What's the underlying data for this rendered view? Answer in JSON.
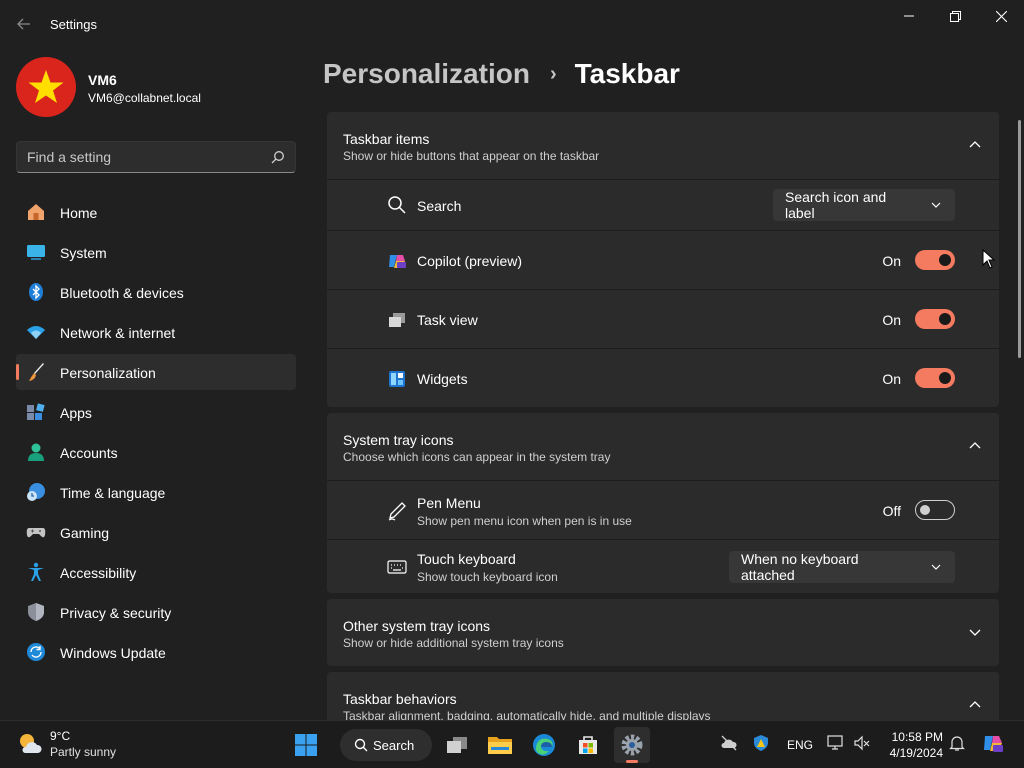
{
  "window": {
    "title": "Settings",
    "controls": [
      "minimize-icon",
      "maximize-icon",
      "close-icon"
    ]
  },
  "profile": {
    "name": "VM6",
    "email": "VM6@collabnet.local"
  },
  "search": {
    "placeholder": "Find a setting"
  },
  "sidebar": {
    "items": [
      {
        "label": "Home",
        "icon": "home-icon"
      },
      {
        "label": "System",
        "icon": "system-icon"
      },
      {
        "label": "Bluetooth & devices",
        "icon": "bluetooth-icon"
      },
      {
        "label": "Network & internet",
        "icon": "wifi-icon"
      },
      {
        "label": "Personalization",
        "icon": "paintbrush-icon",
        "active": true
      },
      {
        "label": "Apps",
        "icon": "apps-icon"
      },
      {
        "label": "Accounts",
        "icon": "accounts-icon"
      },
      {
        "label": "Time & language",
        "icon": "time-language-icon"
      },
      {
        "label": "Gaming",
        "icon": "gamepad-icon"
      },
      {
        "label": "Accessibility",
        "icon": "accessibility-icon"
      },
      {
        "label": "Privacy & security",
        "icon": "shield-icon"
      },
      {
        "label": "Windows Update",
        "icon": "update-icon"
      }
    ]
  },
  "header": {
    "parent": "Personalization",
    "separator": "›",
    "current": "Taskbar"
  },
  "sections": {
    "taskbar_items": {
      "title": "Taskbar items",
      "subtitle": "Show or hide buttons that appear on the taskbar",
      "rows": {
        "search": {
          "label": "Search",
          "value": "Search icon and label"
        },
        "copilot": {
          "label": "Copilot (preview)",
          "state": "On"
        },
        "task_view": {
          "label": "Task view",
          "state": "On"
        },
        "widgets": {
          "label": "Widgets",
          "state": "On"
        }
      }
    },
    "system_tray": {
      "title": "System tray icons",
      "subtitle": "Choose which icons can appear in the system tray",
      "rows": {
        "pen_menu": {
          "label": "Pen Menu",
          "description": "Show pen menu icon when pen is in use",
          "state": "Off"
        },
        "touch_keyboard": {
          "label": "Touch keyboard",
          "description": "Show touch keyboard icon",
          "value": "When no keyboard attached"
        }
      }
    },
    "other_tray": {
      "title": "Other system tray icons",
      "subtitle": "Show or hide additional system tray icons"
    },
    "behaviors": {
      "title": "Taskbar behaviors",
      "subtitle": "Taskbar alignment, badging, automatically hide, and multiple displays"
    }
  },
  "taskbar": {
    "weather": {
      "temp": "9°C",
      "desc": "Partly sunny"
    },
    "search_label": "Search",
    "tray_language": "ENG",
    "clock": {
      "time": "10:58 PM",
      "date": "4/19/2024"
    }
  },
  "colors": {
    "accent": "#f47b5f",
    "background": "#202020",
    "card": "#2b2b2b"
  }
}
